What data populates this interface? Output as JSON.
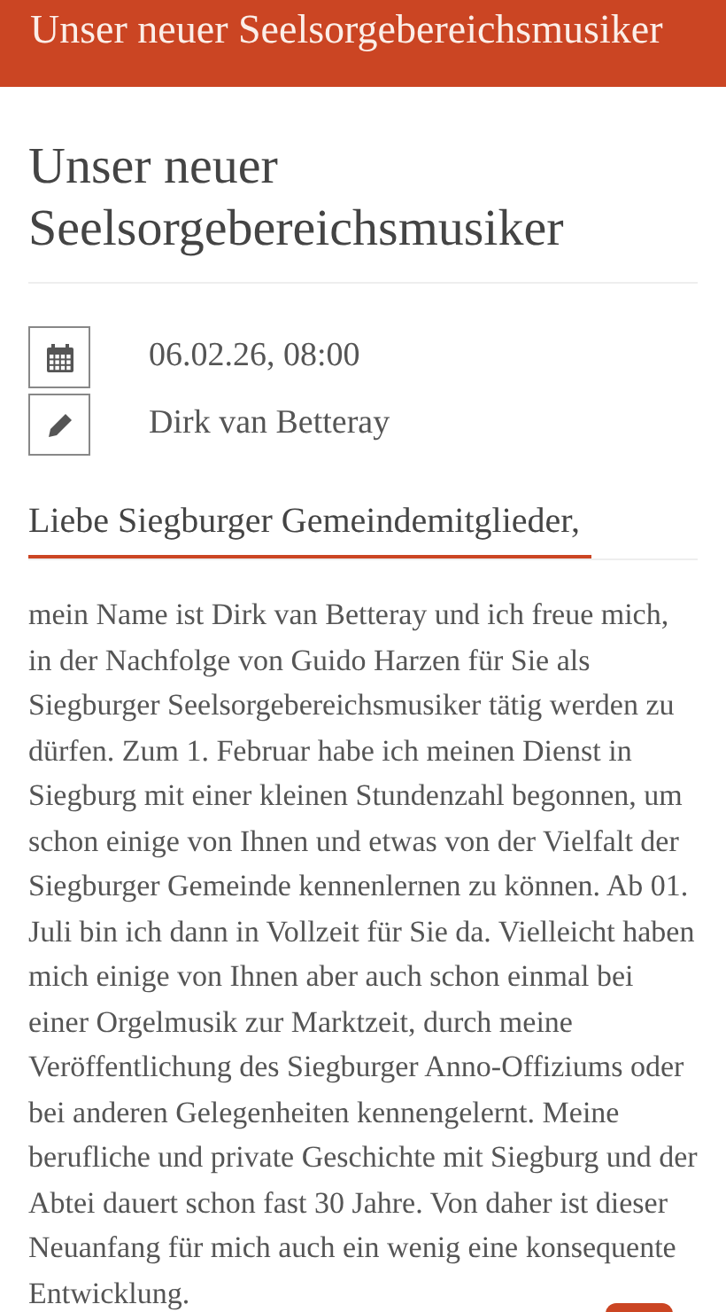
{
  "header": {
    "title": "Unser neuer Seelsorgebereichsmusiker"
  },
  "article": {
    "title": "Unser neuer Seelsorgebereichsmusiker",
    "meta": [
      {
        "kind": "date",
        "text": "06.02.26, 08:00"
      },
      {
        "kind": "author",
        "text": "Dirk van Betteray"
      }
    ],
    "heading": "Liebe Siegburger Gemeindemitglieder,",
    "body": "mein Name ist Dirk van Betteray und ich freue mich, in der Nachfolge von Guido Harzen für Sie als Siegburger Seelsorgebereichsmusiker tätig werden zu dürfen. Zum 1. Februar habe ich meinen Dienst in Siegburg mit einer kleinen Stundenzahl begonnen, um schon einige von Ihnen und etwas von der Vielfalt der Siegburger Gemeinde kennenlernen zu können. Ab 01. Juli bin ich dann in Vollzeit für Sie da. Vielleicht haben mich einige von Ihnen aber auch schon einmal bei einer Orgelmusik zur Marktzeit, durch meine Veröffentlichung des Siegburger Anno-Offiziums oder bei anderen Gelegenheiten kennengelernt.  Meine berufliche und private Geschichte mit Siegburg und der Abtei dauert schon fast 30 Jahre. Von daher ist dieser Neuanfang für mich auch ein wenig eine konsequente Entwicklung."
  }
}
